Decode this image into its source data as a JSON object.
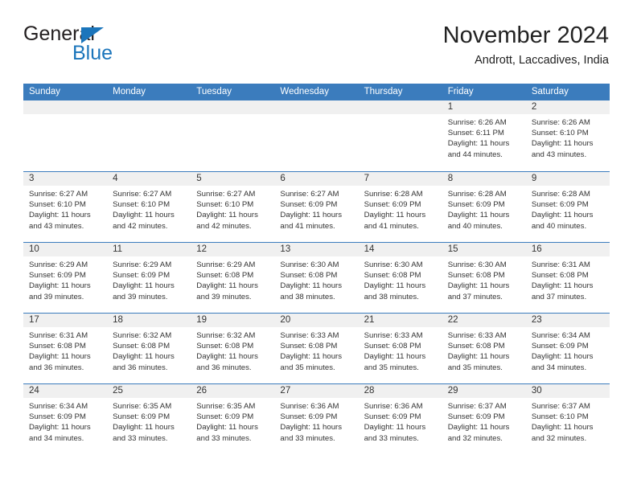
{
  "brand": {
    "name_top": "General",
    "name_bottom": "Blue",
    "triangle_icon": "blue-triangle-icon",
    "color_dark": "#231f20",
    "color_blue": "#1b75bb"
  },
  "header": {
    "month_title": "November 2024",
    "location": "Andrott, Laccadives, India"
  },
  "colors": {
    "header_blue": "#3b7cbd",
    "date_band_gray": "#f0f0f0",
    "cell_white": "#ffffff",
    "text": "#333333"
  },
  "calendar": {
    "weekday_headers": [
      "Sunday",
      "Monday",
      "Tuesday",
      "Wednesday",
      "Thursday",
      "Friday",
      "Saturday"
    ],
    "weeks": [
      [
        {
          "day": "",
          "lines": []
        },
        {
          "day": "",
          "lines": []
        },
        {
          "day": "",
          "lines": []
        },
        {
          "day": "",
          "lines": []
        },
        {
          "day": "",
          "lines": []
        },
        {
          "day": "1",
          "lines": [
            "Sunrise: 6:26 AM",
            "Sunset: 6:11 PM",
            "Daylight: 11 hours",
            "and 44 minutes."
          ]
        },
        {
          "day": "2",
          "lines": [
            "Sunrise: 6:26 AM",
            "Sunset: 6:10 PM",
            "Daylight: 11 hours",
            "and 43 minutes."
          ]
        }
      ],
      [
        {
          "day": "3",
          "lines": [
            "Sunrise: 6:27 AM",
            "Sunset: 6:10 PM",
            "Daylight: 11 hours",
            "and 43 minutes."
          ]
        },
        {
          "day": "4",
          "lines": [
            "Sunrise: 6:27 AM",
            "Sunset: 6:10 PM",
            "Daylight: 11 hours",
            "and 42 minutes."
          ]
        },
        {
          "day": "5",
          "lines": [
            "Sunrise: 6:27 AM",
            "Sunset: 6:10 PM",
            "Daylight: 11 hours",
            "and 42 minutes."
          ]
        },
        {
          "day": "6",
          "lines": [
            "Sunrise: 6:27 AM",
            "Sunset: 6:09 PM",
            "Daylight: 11 hours",
            "and 41 minutes."
          ]
        },
        {
          "day": "7",
          "lines": [
            "Sunrise: 6:28 AM",
            "Sunset: 6:09 PM",
            "Daylight: 11 hours",
            "and 41 minutes."
          ]
        },
        {
          "day": "8",
          "lines": [
            "Sunrise: 6:28 AM",
            "Sunset: 6:09 PM",
            "Daylight: 11 hours",
            "and 40 minutes."
          ]
        },
        {
          "day": "9",
          "lines": [
            "Sunrise: 6:28 AM",
            "Sunset: 6:09 PM",
            "Daylight: 11 hours",
            "and 40 minutes."
          ]
        }
      ],
      [
        {
          "day": "10",
          "lines": [
            "Sunrise: 6:29 AM",
            "Sunset: 6:09 PM",
            "Daylight: 11 hours",
            "and 39 minutes."
          ]
        },
        {
          "day": "11",
          "lines": [
            "Sunrise: 6:29 AM",
            "Sunset: 6:09 PM",
            "Daylight: 11 hours",
            "and 39 minutes."
          ]
        },
        {
          "day": "12",
          "lines": [
            "Sunrise: 6:29 AM",
            "Sunset: 6:08 PM",
            "Daylight: 11 hours",
            "and 39 minutes."
          ]
        },
        {
          "day": "13",
          "lines": [
            "Sunrise: 6:30 AM",
            "Sunset: 6:08 PM",
            "Daylight: 11 hours",
            "and 38 minutes."
          ]
        },
        {
          "day": "14",
          "lines": [
            "Sunrise: 6:30 AM",
            "Sunset: 6:08 PM",
            "Daylight: 11 hours",
            "and 38 minutes."
          ]
        },
        {
          "day": "15",
          "lines": [
            "Sunrise: 6:30 AM",
            "Sunset: 6:08 PM",
            "Daylight: 11 hours",
            "and 37 minutes."
          ]
        },
        {
          "day": "16",
          "lines": [
            "Sunrise: 6:31 AM",
            "Sunset: 6:08 PM",
            "Daylight: 11 hours",
            "and 37 minutes."
          ]
        }
      ],
      [
        {
          "day": "17",
          "lines": [
            "Sunrise: 6:31 AM",
            "Sunset: 6:08 PM",
            "Daylight: 11 hours",
            "and 36 minutes."
          ]
        },
        {
          "day": "18",
          "lines": [
            "Sunrise: 6:32 AM",
            "Sunset: 6:08 PM",
            "Daylight: 11 hours",
            "and 36 minutes."
          ]
        },
        {
          "day": "19",
          "lines": [
            "Sunrise: 6:32 AM",
            "Sunset: 6:08 PM",
            "Daylight: 11 hours",
            "and 36 minutes."
          ]
        },
        {
          "day": "20",
          "lines": [
            "Sunrise: 6:33 AM",
            "Sunset: 6:08 PM",
            "Daylight: 11 hours",
            "and 35 minutes."
          ]
        },
        {
          "day": "21",
          "lines": [
            "Sunrise: 6:33 AM",
            "Sunset: 6:08 PM",
            "Daylight: 11 hours",
            "and 35 minutes."
          ]
        },
        {
          "day": "22",
          "lines": [
            "Sunrise: 6:33 AM",
            "Sunset: 6:08 PM",
            "Daylight: 11 hours",
            "and 35 minutes."
          ]
        },
        {
          "day": "23",
          "lines": [
            "Sunrise: 6:34 AM",
            "Sunset: 6:09 PM",
            "Daylight: 11 hours",
            "and 34 minutes."
          ]
        }
      ],
      [
        {
          "day": "24",
          "lines": [
            "Sunrise: 6:34 AM",
            "Sunset: 6:09 PM",
            "Daylight: 11 hours",
            "and 34 minutes."
          ]
        },
        {
          "day": "25",
          "lines": [
            "Sunrise: 6:35 AM",
            "Sunset: 6:09 PM",
            "Daylight: 11 hours",
            "and 33 minutes."
          ]
        },
        {
          "day": "26",
          "lines": [
            "Sunrise: 6:35 AM",
            "Sunset: 6:09 PM",
            "Daylight: 11 hours",
            "and 33 minutes."
          ]
        },
        {
          "day": "27",
          "lines": [
            "Sunrise: 6:36 AM",
            "Sunset: 6:09 PM",
            "Daylight: 11 hours",
            "and 33 minutes."
          ]
        },
        {
          "day": "28",
          "lines": [
            "Sunrise: 6:36 AM",
            "Sunset: 6:09 PM",
            "Daylight: 11 hours",
            "and 33 minutes."
          ]
        },
        {
          "day": "29",
          "lines": [
            "Sunrise: 6:37 AM",
            "Sunset: 6:09 PM",
            "Daylight: 11 hours",
            "and 32 minutes."
          ]
        },
        {
          "day": "30",
          "lines": [
            "Sunrise: 6:37 AM",
            "Sunset: 6:10 PM",
            "Daylight: 11 hours",
            "and 32 minutes."
          ]
        }
      ]
    ]
  }
}
